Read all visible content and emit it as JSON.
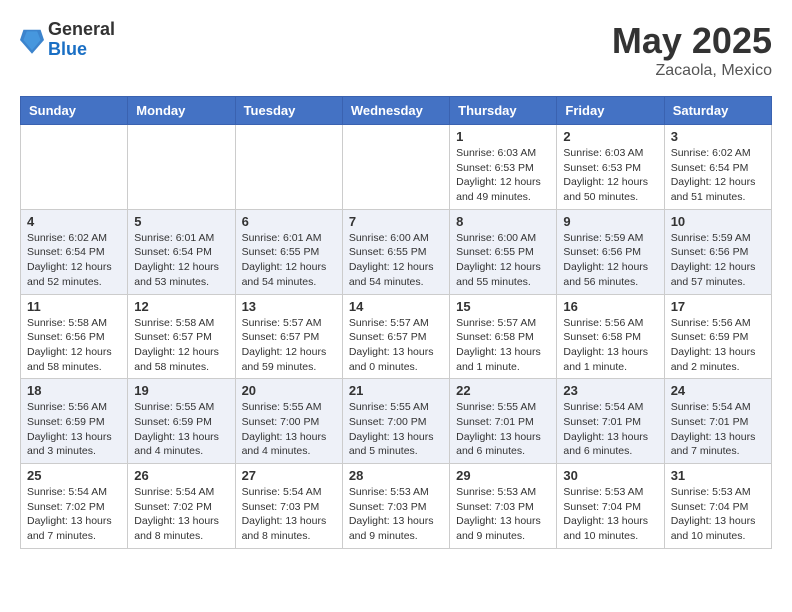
{
  "header": {
    "logo_general": "General",
    "logo_blue": "Blue",
    "month_year": "May 2025",
    "location": "Zacaola, Mexico"
  },
  "days_of_week": [
    "Sunday",
    "Monday",
    "Tuesday",
    "Wednesday",
    "Thursday",
    "Friday",
    "Saturday"
  ],
  "weeks": [
    {
      "row_class": "row-odd",
      "days": [
        {
          "num": "",
          "info": ""
        },
        {
          "num": "",
          "info": ""
        },
        {
          "num": "",
          "info": ""
        },
        {
          "num": "",
          "info": ""
        },
        {
          "num": "1",
          "info": "Sunrise: 6:03 AM\nSunset: 6:53 PM\nDaylight: 12 hours\nand 49 minutes."
        },
        {
          "num": "2",
          "info": "Sunrise: 6:03 AM\nSunset: 6:53 PM\nDaylight: 12 hours\nand 50 minutes."
        },
        {
          "num": "3",
          "info": "Sunrise: 6:02 AM\nSunset: 6:54 PM\nDaylight: 12 hours\nand 51 minutes."
        }
      ]
    },
    {
      "row_class": "row-even",
      "days": [
        {
          "num": "4",
          "info": "Sunrise: 6:02 AM\nSunset: 6:54 PM\nDaylight: 12 hours\nand 52 minutes."
        },
        {
          "num": "5",
          "info": "Sunrise: 6:01 AM\nSunset: 6:54 PM\nDaylight: 12 hours\nand 53 minutes."
        },
        {
          "num": "6",
          "info": "Sunrise: 6:01 AM\nSunset: 6:55 PM\nDaylight: 12 hours\nand 54 minutes."
        },
        {
          "num": "7",
          "info": "Sunrise: 6:00 AM\nSunset: 6:55 PM\nDaylight: 12 hours\nand 54 minutes."
        },
        {
          "num": "8",
          "info": "Sunrise: 6:00 AM\nSunset: 6:55 PM\nDaylight: 12 hours\nand 55 minutes."
        },
        {
          "num": "9",
          "info": "Sunrise: 5:59 AM\nSunset: 6:56 PM\nDaylight: 12 hours\nand 56 minutes."
        },
        {
          "num": "10",
          "info": "Sunrise: 5:59 AM\nSunset: 6:56 PM\nDaylight: 12 hours\nand 57 minutes."
        }
      ]
    },
    {
      "row_class": "row-odd",
      "days": [
        {
          "num": "11",
          "info": "Sunrise: 5:58 AM\nSunset: 6:56 PM\nDaylight: 12 hours\nand 58 minutes."
        },
        {
          "num": "12",
          "info": "Sunrise: 5:58 AM\nSunset: 6:57 PM\nDaylight: 12 hours\nand 58 minutes."
        },
        {
          "num": "13",
          "info": "Sunrise: 5:57 AM\nSunset: 6:57 PM\nDaylight: 12 hours\nand 59 minutes."
        },
        {
          "num": "14",
          "info": "Sunrise: 5:57 AM\nSunset: 6:57 PM\nDaylight: 13 hours\nand 0 minutes."
        },
        {
          "num": "15",
          "info": "Sunrise: 5:57 AM\nSunset: 6:58 PM\nDaylight: 13 hours\nand 1 minute."
        },
        {
          "num": "16",
          "info": "Sunrise: 5:56 AM\nSunset: 6:58 PM\nDaylight: 13 hours\nand 1 minute."
        },
        {
          "num": "17",
          "info": "Sunrise: 5:56 AM\nSunset: 6:59 PM\nDaylight: 13 hours\nand 2 minutes."
        }
      ]
    },
    {
      "row_class": "row-even",
      "days": [
        {
          "num": "18",
          "info": "Sunrise: 5:56 AM\nSunset: 6:59 PM\nDaylight: 13 hours\nand 3 minutes."
        },
        {
          "num": "19",
          "info": "Sunrise: 5:55 AM\nSunset: 6:59 PM\nDaylight: 13 hours\nand 4 minutes."
        },
        {
          "num": "20",
          "info": "Sunrise: 5:55 AM\nSunset: 7:00 PM\nDaylight: 13 hours\nand 4 minutes."
        },
        {
          "num": "21",
          "info": "Sunrise: 5:55 AM\nSunset: 7:00 PM\nDaylight: 13 hours\nand 5 minutes."
        },
        {
          "num": "22",
          "info": "Sunrise: 5:55 AM\nSunset: 7:01 PM\nDaylight: 13 hours\nand 6 minutes."
        },
        {
          "num": "23",
          "info": "Sunrise: 5:54 AM\nSunset: 7:01 PM\nDaylight: 13 hours\nand 6 minutes."
        },
        {
          "num": "24",
          "info": "Sunrise: 5:54 AM\nSunset: 7:01 PM\nDaylight: 13 hours\nand 7 minutes."
        }
      ]
    },
    {
      "row_class": "row-odd",
      "days": [
        {
          "num": "25",
          "info": "Sunrise: 5:54 AM\nSunset: 7:02 PM\nDaylight: 13 hours\nand 7 minutes."
        },
        {
          "num": "26",
          "info": "Sunrise: 5:54 AM\nSunset: 7:02 PM\nDaylight: 13 hours\nand 8 minutes."
        },
        {
          "num": "27",
          "info": "Sunrise: 5:54 AM\nSunset: 7:03 PM\nDaylight: 13 hours\nand 8 minutes."
        },
        {
          "num": "28",
          "info": "Sunrise: 5:53 AM\nSunset: 7:03 PM\nDaylight: 13 hours\nand 9 minutes."
        },
        {
          "num": "29",
          "info": "Sunrise: 5:53 AM\nSunset: 7:03 PM\nDaylight: 13 hours\nand 9 minutes."
        },
        {
          "num": "30",
          "info": "Sunrise: 5:53 AM\nSunset: 7:04 PM\nDaylight: 13 hours\nand 10 minutes."
        },
        {
          "num": "31",
          "info": "Sunrise: 5:53 AM\nSunset: 7:04 PM\nDaylight: 13 hours\nand 10 minutes."
        }
      ]
    }
  ]
}
